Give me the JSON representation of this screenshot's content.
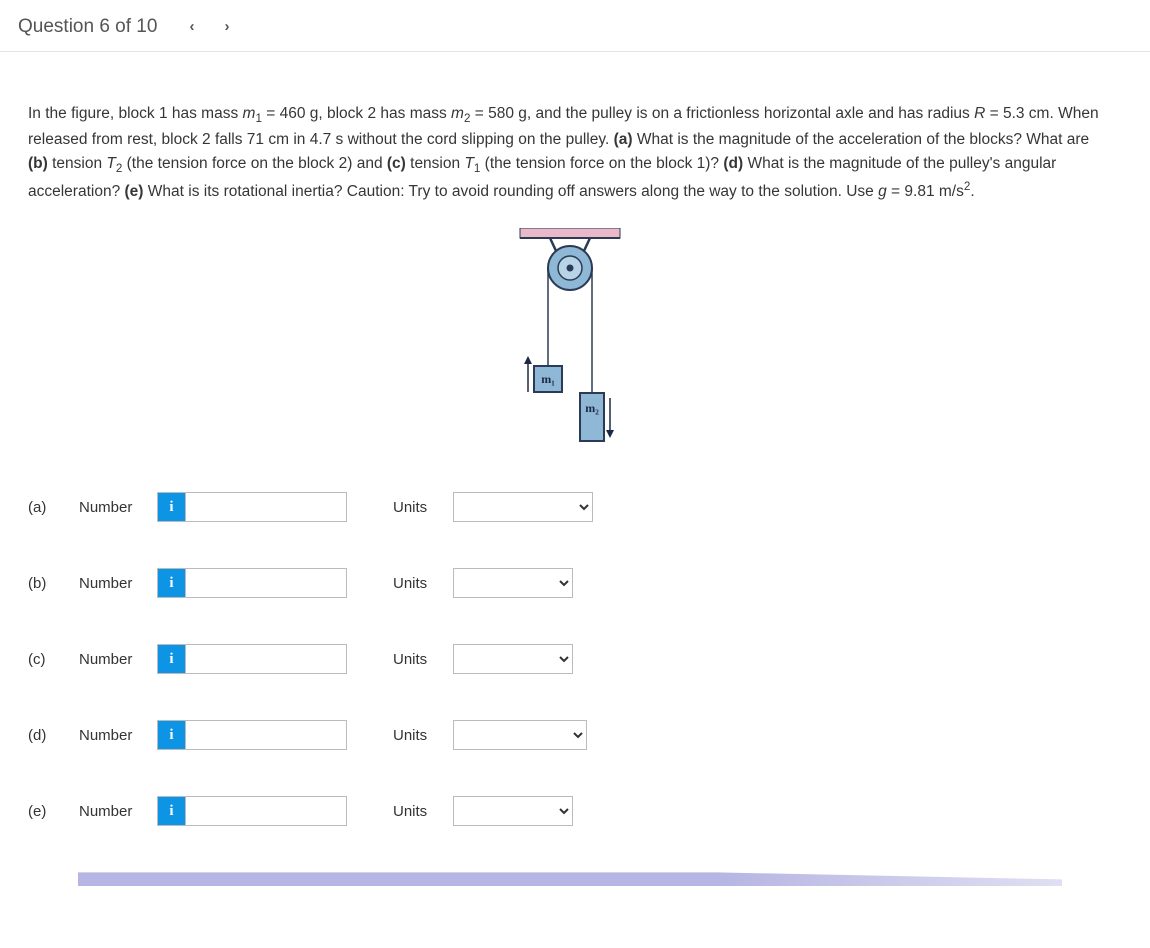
{
  "header": {
    "title": "Question 6 of 10"
  },
  "problem": {
    "html": "In the figure, block 1 has mass <i>m</i><sub>1</sub> = 460 g, block 2 has mass <i>m</i><sub>2</sub> = 580 g, and the pulley is on a frictionless horizontal axle and has radius <i>R</i> = 5.3 cm. When released from rest, block 2 falls 71 cm in 4.7 s without the cord slipping on the pulley. <b>(a)</b> What is the magnitude of the acceleration of the blocks? What are <b>(b)</b> tension <i>T</i><sub>2</sub> (the tension force on the block 2) and <b>(c)</b> tension <i>T</i><sub>1</sub> (the tension force on the block 1)? <b>(d)</b> What is the magnitude of the pulley's angular acceleration? <b>(e)</b> What is its rotational inertia? Caution: Try to avoid rounding off answers along the way to the solution. Use <i>g</i> = 9.81 m/s<sup>2</sup>."
  },
  "figure": {
    "m1_label": "m₁",
    "m2_label": "m₂"
  },
  "answers": {
    "number_label": "Number",
    "units_label": "Units",
    "info_glyph": "i",
    "parts": [
      {
        "id": "a",
        "label": "(a)"
      },
      {
        "id": "b",
        "label": "(b)"
      },
      {
        "id": "c",
        "label": "(c)"
      },
      {
        "id": "d",
        "label": "(d)"
      },
      {
        "id": "e",
        "label": "(e)"
      }
    ]
  }
}
